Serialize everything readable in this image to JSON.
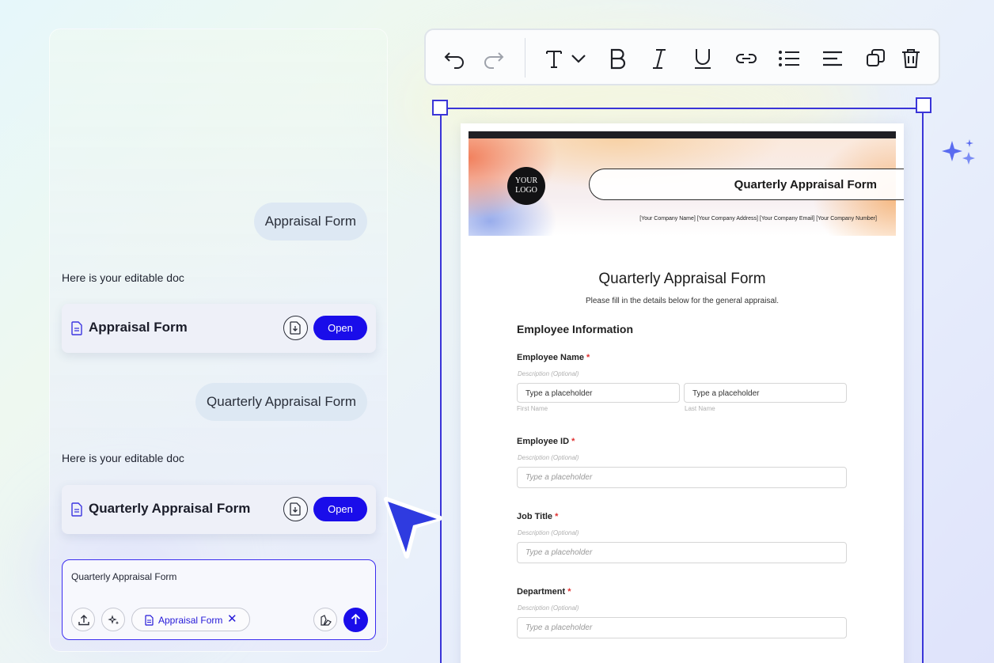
{
  "chat": {
    "messages": [
      {
        "role": "user",
        "text": "Appraisal Form"
      },
      {
        "role": "bot",
        "text": "Here is your editable doc",
        "doc_title": "Appraisal Form",
        "open_label": "Open"
      },
      {
        "role": "user",
        "text": "Quarterly Appraisal Form"
      },
      {
        "role": "bot",
        "text": "Here is your editable doc",
        "doc_title": "Quarterly Appraisal Form",
        "open_label": "Open"
      }
    ],
    "input": {
      "value": "Quarterly Appraisal Form",
      "attachment_chip": "Appraisal Form",
      "chip_close": "✕"
    }
  },
  "toolbar": {
    "tools": [
      "undo-icon",
      "redo-icon",
      "text-style-icon",
      "chevron-down-icon",
      "bold-icon",
      "italic-icon",
      "underline-icon",
      "link-icon",
      "bullet-list-icon",
      "align-left-icon",
      "duplicate-icon",
      "delete-icon"
    ]
  },
  "document": {
    "logo_line1": "YOUR",
    "logo_line2": "LOGO",
    "header_title": "Quarterly Appraisal Form",
    "company_line": "[Your Company Name] [Your Company Address] [Your Company Email] [Your Company Number]",
    "form_title": "Quarterly Appraisal Form",
    "form_subtitle": "Please fill in the details below for the general appraisal.",
    "section_title": "Employee Information",
    "required_mark": "*",
    "fields": [
      {
        "label": "Employee Name",
        "description": "Description (Optional)",
        "placeholder_first": "Type a placeholder",
        "placeholder_last": "Type a placeholder",
        "sub_first": "First Name",
        "sub_last": "Last Name"
      },
      {
        "label": "Employee ID",
        "description": "Description (Optional)",
        "placeholder": "Type a placeholder"
      },
      {
        "label": "Job Title",
        "description": "Description (Optional)",
        "placeholder": "Type a placeholder"
      },
      {
        "label": "Department",
        "description": "Description (Optional)",
        "placeholder": "Type a placeholder"
      }
    ]
  },
  "colors": {
    "accent": "#1a0dea",
    "selection": "#3a35d8",
    "sparkle": "#5a6cf0"
  }
}
